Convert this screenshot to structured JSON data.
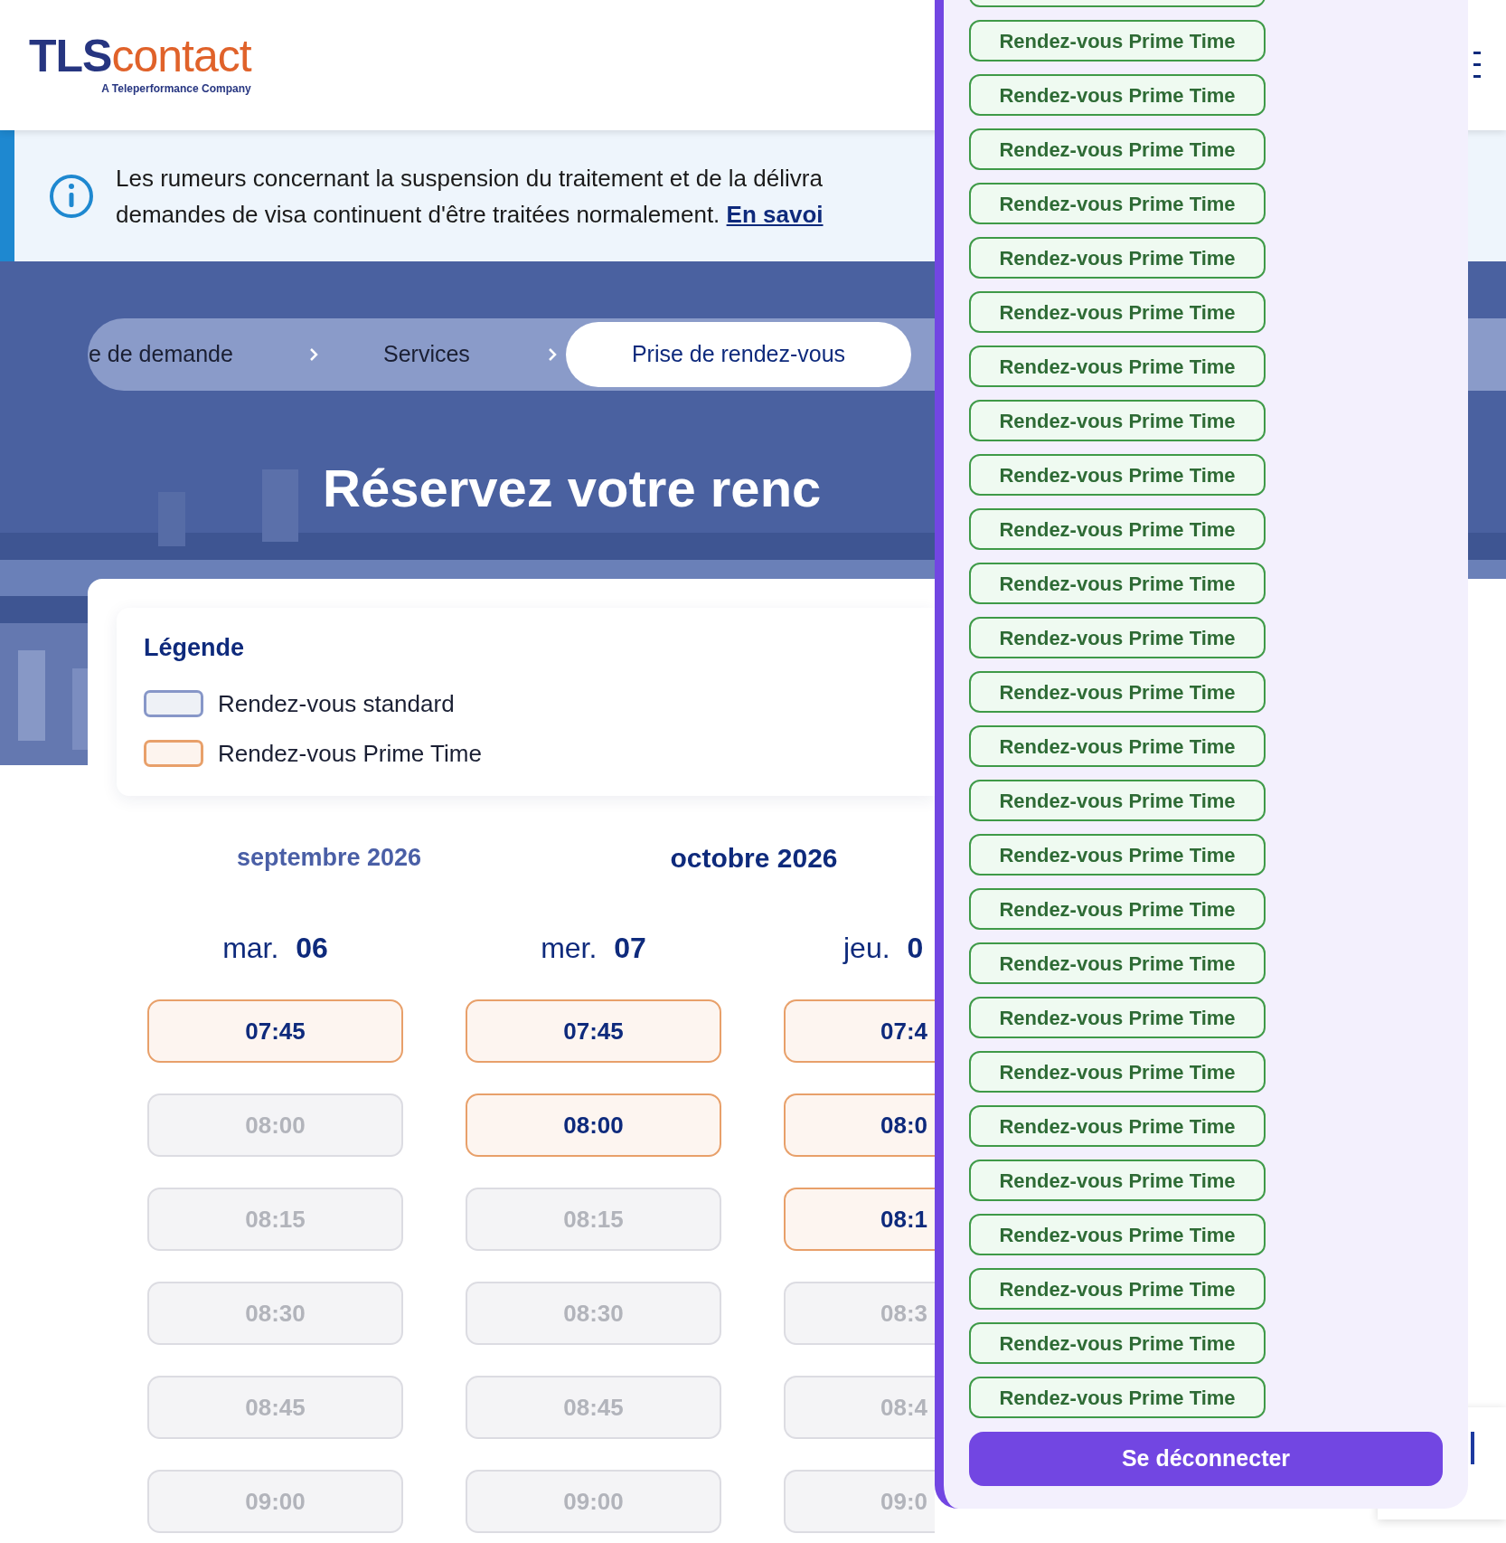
{
  "header": {
    "logo": {
      "initials": "TLS",
      "word": "contact",
      "tagline": "A Teleperformance Company"
    }
  },
  "notice": {
    "lines": [
      "Les rumeurs concernant la suspension du traitement et de la délivra",
      "demandes de visa continuent d'être traitées normalement."
    ],
    "link": "En savoi"
  },
  "breadcrumb": [
    {
      "label": "e de demande",
      "selected": false
    },
    {
      "label": "Services",
      "selected": false
    },
    {
      "label": "Prise de rendez-vous",
      "selected": true
    }
  ],
  "title": "Réservez votre renc",
  "legend": {
    "title": "Légende",
    "items": [
      {
        "label": "Rendez-vous standard",
        "kind": "standard"
      },
      {
        "label": "Rendez-vous Prime Time",
        "kind": "prime"
      }
    ]
  },
  "months": [
    {
      "label": "septembre 2026",
      "selected": false
    },
    {
      "label": "octobre 2026",
      "selected": true
    }
  ],
  "days": [
    {
      "weekday": "mar.",
      "day": "06",
      "slots": [
        {
          "time": "07:45",
          "disabled": false
        },
        {
          "time": "08:00",
          "disabled": true
        },
        {
          "time": "08:15",
          "disabled": true
        },
        {
          "time": "08:30",
          "disabled": true
        },
        {
          "time": "08:45",
          "disabled": true
        },
        {
          "time": "09:00",
          "disabled": true
        }
      ]
    },
    {
      "weekday": "mer.",
      "day": "07",
      "slots": [
        {
          "time": "07:45",
          "disabled": false
        },
        {
          "time": "08:00",
          "disabled": false
        },
        {
          "time": "08:15",
          "disabled": true
        },
        {
          "time": "08:30",
          "disabled": true
        },
        {
          "time": "08:45",
          "disabled": true
        },
        {
          "time": "09:00",
          "disabled": true
        }
      ]
    },
    {
      "weekday": "jeu.",
      "day": "0",
      "slots": [
        {
          "time": "07:4",
          "disabled": false
        },
        {
          "time": "08:0",
          "disabled": false
        },
        {
          "time": "08:1",
          "disabled": false
        },
        {
          "time": "08:3",
          "disabled": true
        },
        {
          "time": "08:4",
          "disabled": true
        },
        {
          "time": "09:0",
          "disabled": true
        }
      ]
    }
  ],
  "panel": {
    "badges": [
      "Rendez-vous Prime Time",
      "Rendez-vous Prime Time",
      "Rendez-vous Prime Time",
      "Rendez-vous Prime Time",
      "Rendez-vous Prime Time",
      "Rendez-vous Prime Time",
      "Rendez-vous Prime Time",
      "Rendez-vous Prime Time",
      "Rendez-vous Prime Time",
      "Rendez-vous Prime Time",
      "Rendez-vous Prime Time",
      "Rendez-vous Prime Time",
      "Rendez-vous Prime Time",
      "Rendez-vous Prime Time",
      "Rendez-vous Prime Time",
      "Rendez-vous Prime Time",
      "Rendez-vous Prime Time",
      "Rendez-vous Prime Time",
      "Rendez-vous Prime Time",
      "Rendez-vous Prime Time",
      "Rendez-vous Prime Time",
      "Rendez-vous Prime Time",
      "Rendez-vous Prime Time",
      "Rendez-vous Prime Time",
      "Rendez-vous Prime Time",
      "Rendez-vous Prime Time"
    ],
    "logout": "Se déconnecter"
  }
}
